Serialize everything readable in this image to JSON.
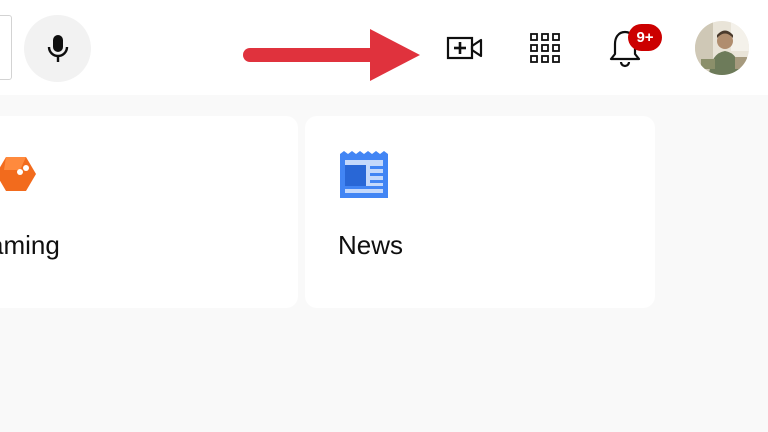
{
  "header": {
    "mic_icon": "microphone-icon",
    "create_icon": "video-create-icon",
    "apps_icon": "apps-grid-icon",
    "notifications_icon": "bell-icon",
    "notifications_badge": "9+",
    "badge_color": "#cc0000",
    "annotation_arrow_color": "#e0323d"
  },
  "cards": [
    {
      "label": "aming",
      "icon": "gaming-icon",
      "icon_color": "#f26b1d"
    },
    {
      "label": "News",
      "icon": "news-icon",
      "icon_color": "#4285f4"
    }
  ]
}
